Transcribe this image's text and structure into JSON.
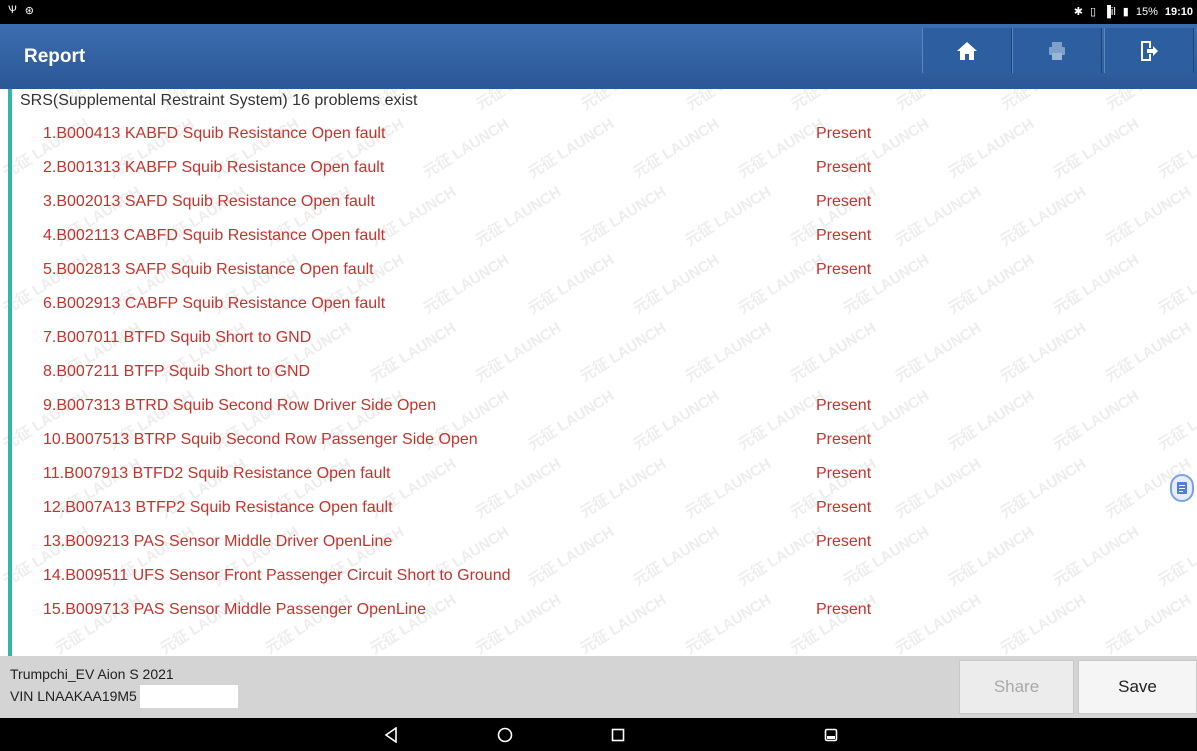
{
  "statusbar": {
    "left_icons": [
      "usb-icon",
      "gear-badge-icon"
    ],
    "bluetooth": "✱",
    "signal": "▐il",
    "battery": "15%",
    "time": "19:10"
  },
  "header": {
    "title": "Report",
    "buttons": [
      "home-icon",
      "print-icon",
      "exit-icon"
    ]
  },
  "report": {
    "heading": "SRS(Supplemental Restraint System) 16 problems exist",
    "items": [
      {
        "code": "1.B000413 KABFD Squib Resistance Open fault",
        "status": "Present"
      },
      {
        "code": "2.B001313 KABFP Squib Resistance Open fault",
        "status": "Present"
      },
      {
        "code": "3.B002013 SAFD Squib Resistance Open fault",
        "status": "Present"
      },
      {
        "code": "4.B002113 CABFD Squib Resistance Open fault",
        "status": "Present"
      },
      {
        "code": "5.B002813 SAFP Squib Resistance Open fault",
        "status": "Present"
      },
      {
        "code": "6.B002913 CABFP Squib Resistance Open fault",
        "status": ""
      },
      {
        "code": "7.B007011 BTFD Squib Short to GND",
        "status": ""
      },
      {
        "code": "8.B007211 BTFP Squib Short to GND",
        "status": ""
      },
      {
        "code": "9.B007313 BTRD Squib Second Row Driver Side Open",
        "status": "Present"
      },
      {
        "code": "10.B007513 BTRP Squib Second Row Passenger Side Open",
        "status": "Present"
      },
      {
        "code": "11.B007913 BTFD2 Squib Resistance Open fault",
        "status": "Present"
      },
      {
        "code": "12.B007A13 BTFP2 Squib Resistance Open fault",
        "status": "Present"
      },
      {
        "code": "13.B009213 PAS Sensor  Middle Driver  OpenLine",
        "status": "Present"
      },
      {
        "code": "14.B009511 UFS Sensor  Front Passenger Circuit Short to Ground",
        "status": ""
      },
      {
        "code": "15.B009713 PAS Sensor  Middle Passenger  OpenLine",
        "status": "Present"
      }
    ],
    "watermark_text": "元征 LAUNCH"
  },
  "footer": {
    "vehicle": "Trumpchi_EV Aion S 2021",
    "vin": "VIN LNAAKAA19M5",
    "share_label": "Share",
    "save_label": "Save"
  },
  "colors": {
    "header_bg": "#2f5e9f",
    "fault_text": "#c4332c",
    "accent_bar": "#2fb8a6",
    "footer_bg": "#d4d4d4"
  }
}
